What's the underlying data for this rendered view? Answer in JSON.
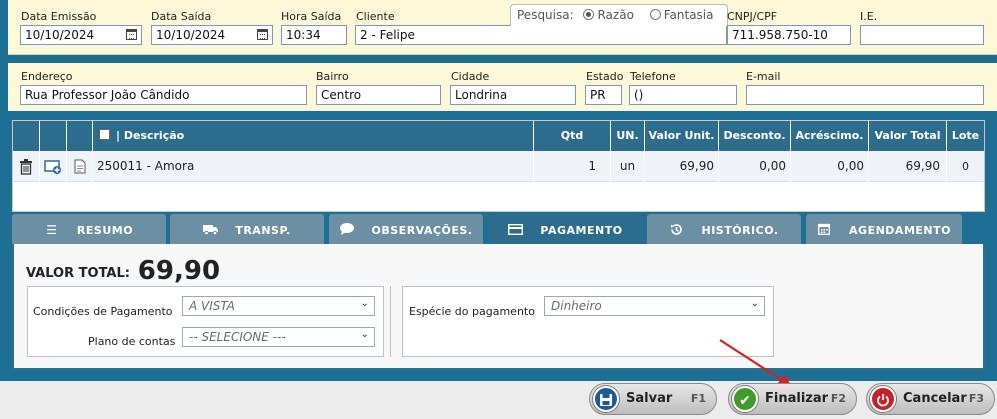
{
  "header": {
    "data_emissao_label": "Data Emissão",
    "data_emissao": "10/10/2024",
    "data_saida_label": "Data Saída",
    "data_saida": "10/10/2024",
    "hora_saida_label": "Hora Saída",
    "hora_saida": "10:34",
    "cliente_label": "Cliente",
    "cliente": "2 - Felipe",
    "pesquisa_label": "Pesquisa:",
    "pesquisa_razao": "Razão",
    "pesquisa_fantasia": "Fantasia",
    "cnpj_label": "CNPJ/CPF",
    "cnpj": "711.958.750-10",
    "ie_label": "I.E.",
    "ie": ""
  },
  "address": {
    "endereco_label": "Endereço",
    "endereco": "Rua Professor João Cândido",
    "bairro_label": "Bairro",
    "bairro": "Centro",
    "cidade_label": "Cidade",
    "cidade": "Londrina",
    "estado_label": "Estado",
    "estado": "PR",
    "telefone_label": "Telefone",
    "telefone": "()",
    "email_label": "E-mail",
    "email": ""
  },
  "table": {
    "columns": {
      "descricao": "| Descrição",
      "qtd": "Qtd",
      "un": "UN.",
      "valor_unit": "Valor Unit.",
      "desconto": "Desconto.",
      "acrescimo": "Acréscimo.",
      "valor_total": "Valor Total",
      "lote": "Lote"
    },
    "rows": [
      {
        "descricao": "250011 - Amora",
        "qtd": "1",
        "un": "un",
        "valor_unit": "69,90",
        "desconto": "0,00",
        "acrescimo": "0,00",
        "valor_total": "69,90",
        "lote": "0"
      }
    ]
  },
  "tabs": [
    {
      "label": "RESUMO",
      "icon": "list-icon",
      "active": false
    },
    {
      "label": "TRANSP.",
      "icon": "truck-icon",
      "active": false
    },
    {
      "label": "OBSERVAÇÕES.",
      "icon": "comment-icon",
      "active": false
    },
    {
      "label": "PAGAMENTO",
      "icon": "credit-card-icon",
      "active": true
    },
    {
      "label": "HISTÓRICO.",
      "icon": "history-icon",
      "active": false
    },
    {
      "label": "AGENDAMENTO",
      "icon": "calendar-icon",
      "active": false
    }
  ],
  "payment": {
    "valor_total_label": "VALOR TOTAL:",
    "valor_total": "69,90",
    "condicoes_label": "Condições de Pagamento",
    "condicoes_value": "A VISTA",
    "plano_label": "Plano de contas",
    "plano_value": "-- SELECIONE ---",
    "especie_label": "Espécie do pagamento",
    "especie_value": "Dinheiro"
  },
  "buttons": {
    "salvar": "Salvar",
    "salvar_key": "F1",
    "finalizar": "Finalizar",
    "finalizar_key": "F2",
    "cancelar": "Cancelar",
    "cancelar_key": "F3"
  },
  "colors": {
    "header_bg": "#fdf8d7",
    "accent": "#2c6d8e",
    "tab_inactive": "#6d8fa4",
    "arrow": "#d8201c"
  }
}
